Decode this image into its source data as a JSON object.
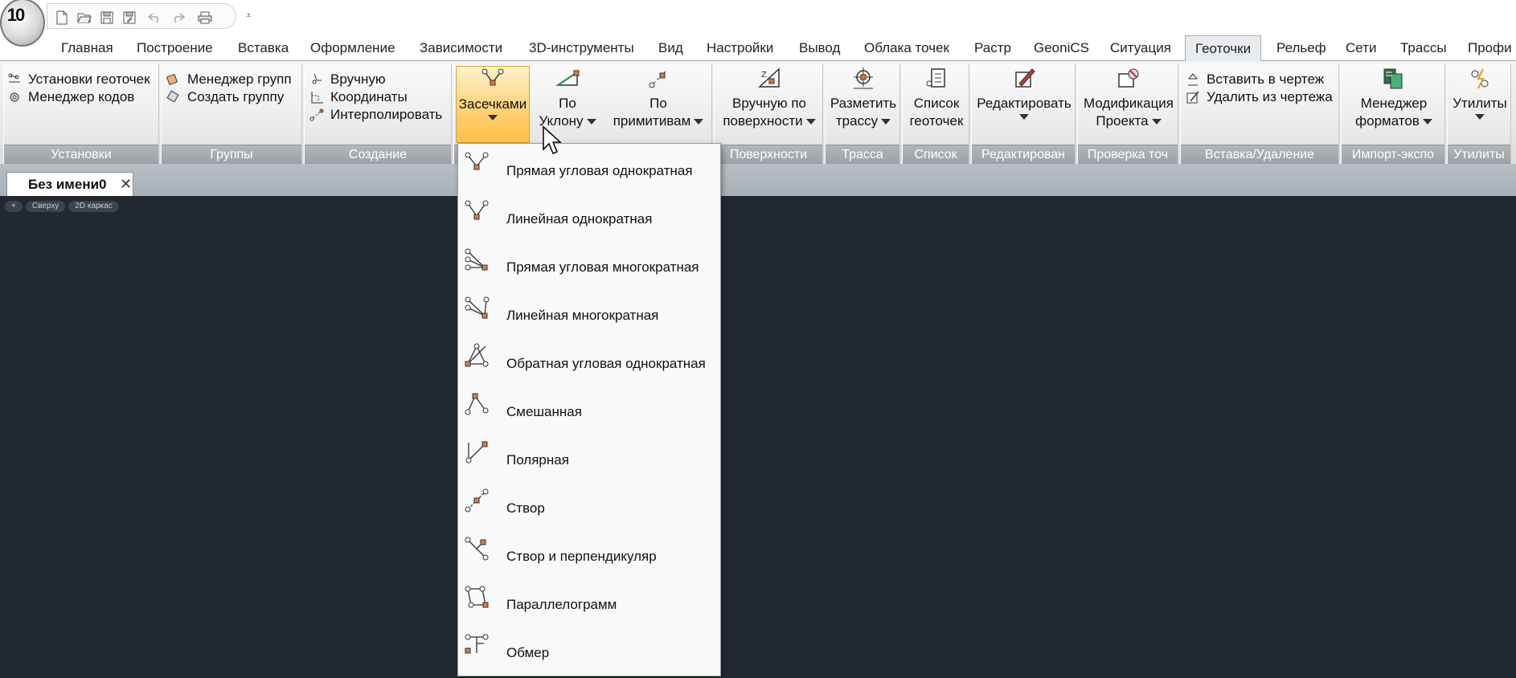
{
  "app": {
    "logo_text": "10"
  },
  "quick_access": {
    "buttons": [
      "new-icon",
      "open-icon",
      "save-icon",
      "save-as-icon",
      "undo-icon",
      "redo-icon",
      "print-icon"
    ],
    "customize": "⩡"
  },
  "ribbon_tabs": [
    "Главная",
    "Построение",
    "Вставка",
    "Оформление",
    "Зависимости",
    "3D-инструменты",
    "Вид",
    "Настройки",
    "Вывод",
    "Облака точек",
    "Растр",
    "GeoniCS",
    "Ситуация",
    "Геоточки",
    "Рельеф",
    "Сети",
    "Трассы",
    "Профи"
  ],
  "active_tab": "Геоточки",
  "panels": {
    "ustanovki": {
      "title": "Установки",
      "items": [
        "Установки геоточек",
        "Менеджер кодов"
      ]
    },
    "gruppy": {
      "title": "Группы",
      "items": [
        "Менеджер групп",
        "Создать группу"
      ]
    },
    "sozdanie": {
      "title": "Создание",
      "items": [
        "Вручную",
        "Координаты",
        "Интерполировать"
      ]
    },
    "zasechkami": {
      "label": "Засечками"
    },
    "po_uklonu": {
      "line1": "По",
      "line2": "Уклону"
    },
    "po_primitivam": {
      "line1": "По",
      "line2": "примитивам"
    },
    "poverkhnosti": {
      "title": "Поверхности",
      "line1": "Вручную по",
      "line2": "поверхности"
    },
    "trassa": {
      "title": "Трасса",
      "line1": "Разметить",
      "line2": "трассу"
    },
    "spisok": {
      "title": "Список",
      "line1": "Список",
      "line2": "геоточек"
    },
    "redaktirovat": {
      "title": "Редактирован",
      "line1": "Редактировать"
    },
    "proverka": {
      "title": "Проверка точ",
      "line1": "Модификация",
      "line2": "Проекта"
    },
    "vstavka": {
      "title": "Вставка/Удаление",
      "items": [
        "Вставить в чертеж",
        "Удалить из чертежа"
      ]
    },
    "import": {
      "title": "Импорт-экспо",
      "line1": "Менеджер",
      "line2": "форматов"
    },
    "utility": {
      "title": "Утилиты",
      "line1": "Утилиты"
    }
  },
  "document": {
    "tab_label": "Без имени0",
    "close": "✕"
  },
  "viewport": {
    "chips": [
      "+",
      "Сверху",
      "2D каркас"
    ]
  },
  "dropdown": {
    "items": [
      "Прямая угловая однократная",
      "Линейная однократная",
      "Прямая угловая многократная",
      "Линейная многократная",
      "Обратная угловая однократная",
      "Смешанная",
      "Полярная",
      "Створ",
      "Створ и перпендикуляр",
      "Параллелограмм",
      "Обмер"
    ]
  },
  "colors": {
    "canvas": "#212830",
    "accent_pressed": "#ffc04a",
    "panel_title": "#9ba0a6",
    "orange_point": "#e07b39"
  }
}
